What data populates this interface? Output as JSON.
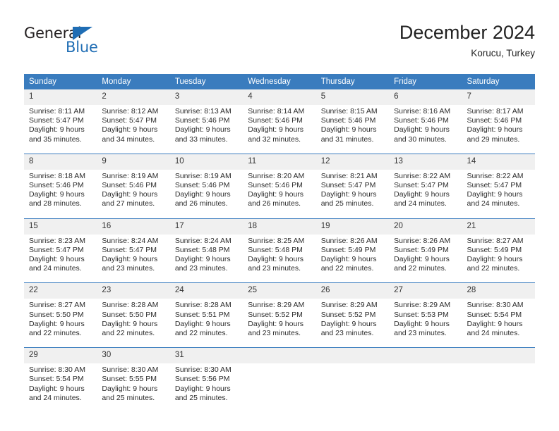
{
  "brand": {
    "name_part1": "General",
    "name_part2": "Blue",
    "triangle_color": "#1f6db4"
  },
  "header": {
    "title": "December 2024",
    "subtitle": "Korucu, Turkey"
  },
  "theme": {
    "header_blue": "#3a7cbe",
    "daynum_gray": "#f0f0f0"
  },
  "calendar": {
    "weekday_headers": [
      "Sunday",
      "Monday",
      "Tuesday",
      "Wednesday",
      "Thursday",
      "Friday",
      "Saturday"
    ],
    "weeks": [
      [
        {
          "day": "1",
          "sunrise": "Sunrise: 8:11 AM",
          "sunset": "Sunset: 5:47 PM",
          "daylight_line1": "Daylight: 9 hours",
          "daylight_line2": "and 35 minutes."
        },
        {
          "day": "2",
          "sunrise": "Sunrise: 8:12 AM",
          "sunset": "Sunset: 5:47 PM",
          "daylight_line1": "Daylight: 9 hours",
          "daylight_line2": "and 34 minutes."
        },
        {
          "day": "3",
          "sunrise": "Sunrise: 8:13 AM",
          "sunset": "Sunset: 5:46 PM",
          "daylight_line1": "Daylight: 9 hours",
          "daylight_line2": "and 33 minutes."
        },
        {
          "day": "4",
          "sunrise": "Sunrise: 8:14 AM",
          "sunset": "Sunset: 5:46 PM",
          "daylight_line1": "Daylight: 9 hours",
          "daylight_line2": "and 32 minutes."
        },
        {
          "day": "5",
          "sunrise": "Sunrise: 8:15 AM",
          "sunset": "Sunset: 5:46 PM",
          "daylight_line1": "Daylight: 9 hours",
          "daylight_line2": "and 31 minutes."
        },
        {
          "day": "6",
          "sunrise": "Sunrise: 8:16 AM",
          "sunset": "Sunset: 5:46 PM",
          "daylight_line1": "Daylight: 9 hours",
          "daylight_line2": "and 30 minutes."
        },
        {
          "day": "7",
          "sunrise": "Sunrise: 8:17 AM",
          "sunset": "Sunset: 5:46 PM",
          "daylight_line1": "Daylight: 9 hours",
          "daylight_line2": "and 29 minutes."
        }
      ],
      [
        {
          "day": "8",
          "sunrise": "Sunrise: 8:18 AM",
          "sunset": "Sunset: 5:46 PM",
          "daylight_line1": "Daylight: 9 hours",
          "daylight_line2": "and 28 minutes."
        },
        {
          "day": "9",
          "sunrise": "Sunrise: 8:19 AM",
          "sunset": "Sunset: 5:46 PM",
          "daylight_line1": "Daylight: 9 hours",
          "daylight_line2": "and 27 minutes."
        },
        {
          "day": "10",
          "sunrise": "Sunrise: 8:19 AM",
          "sunset": "Sunset: 5:46 PM",
          "daylight_line1": "Daylight: 9 hours",
          "daylight_line2": "and 26 minutes."
        },
        {
          "day": "11",
          "sunrise": "Sunrise: 8:20 AM",
          "sunset": "Sunset: 5:46 PM",
          "daylight_line1": "Daylight: 9 hours",
          "daylight_line2": "and 26 minutes."
        },
        {
          "day": "12",
          "sunrise": "Sunrise: 8:21 AM",
          "sunset": "Sunset: 5:47 PM",
          "daylight_line1": "Daylight: 9 hours",
          "daylight_line2": "and 25 minutes."
        },
        {
          "day": "13",
          "sunrise": "Sunrise: 8:22 AM",
          "sunset": "Sunset: 5:47 PM",
          "daylight_line1": "Daylight: 9 hours",
          "daylight_line2": "and 24 minutes."
        },
        {
          "day": "14",
          "sunrise": "Sunrise: 8:22 AM",
          "sunset": "Sunset: 5:47 PM",
          "daylight_line1": "Daylight: 9 hours",
          "daylight_line2": "and 24 minutes."
        }
      ],
      [
        {
          "day": "15",
          "sunrise": "Sunrise: 8:23 AM",
          "sunset": "Sunset: 5:47 PM",
          "daylight_line1": "Daylight: 9 hours",
          "daylight_line2": "and 24 minutes."
        },
        {
          "day": "16",
          "sunrise": "Sunrise: 8:24 AM",
          "sunset": "Sunset: 5:47 PM",
          "daylight_line1": "Daylight: 9 hours",
          "daylight_line2": "and 23 minutes."
        },
        {
          "day": "17",
          "sunrise": "Sunrise: 8:24 AM",
          "sunset": "Sunset: 5:48 PM",
          "daylight_line1": "Daylight: 9 hours",
          "daylight_line2": "and 23 minutes."
        },
        {
          "day": "18",
          "sunrise": "Sunrise: 8:25 AM",
          "sunset": "Sunset: 5:48 PM",
          "daylight_line1": "Daylight: 9 hours",
          "daylight_line2": "and 23 minutes."
        },
        {
          "day": "19",
          "sunrise": "Sunrise: 8:26 AM",
          "sunset": "Sunset: 5:49 PM",
          "daylight_line1": "Daylight: 9 hours",
          "daylight_line2": "and 22 minutes."
        },
        {
          "day": "20",
          "sunrise": "Sunrise: 8:26 AM",
          "sunset": "Sunset: 5:49 PM",
          "daylight_line1": "Daylight: 9 hours",
          "daylight_line2": "and 22 minutes."
        },
        {
          "day": "21",
          "sunrise": "Sunrise: 8:27 AM",
          "sunset": "Sunset: 5:49 PM",
          "daylight_line1": "Daylight: 9 hours",
          "daylight_line2": "and 22 minutes."
        }
      ],
      [
        {
          "day": "22",
          "sunrise": "Sunrise: 8:27 AM",
          "sunset": "Sunset: 5:50 PM",
          "daylight_line1": "Daylight: 9 hours",
          "daylight_line2": "and 22 minutes."
        },
        {
          "day": "23",
          "sunrise": "Sunrise: 8:28 AM",
          "sunset": "Sunset: 5:50 PM",
          "daylight_line1": "Daylight: 9 hours",
          "daylight_line2": "and 22 minutes."
        },
        {
          "day": "24",
          "sunrise": "Sunrise: 8:28 AM",
          "sunset": "Sunset: 5:51 PM",
          "daylight_line1": "Daylight: 9 hours",
          "daylight_line2": "and 22 minutes."
        },
        {
          "day": "25",
          "sunrise": "Sunrise: 8:29 AM",
          "sunset": "Sunset: 5:52 PM",
          "daylight_line1": "Daylight: 9 hours",
          "daylight_line2": "and 23 minutes."
        },
        {
          "day": "26",
          "sunrise": "Sunrise: 8:29 AM",
          "sunset": "Sunset: 5:52 PM",
          "daylight_line1": "Daylight: 9 hours",
          "daylight_line2": "and 23 minutes."
        },
        {
          "day": "27",
          "sunrise": "Sunrise: 8:29 AM",
          "sunset": "Sunset: 5:53 PM",
          "daylight_line1": "Daylight: 9 hours",
          "daylight_line2": "and 23 minutes."
        },
        {
          "day": "28",
          "sunrise": "Sunrise: 8:30 AM",
          "sunset": "Sunset: 5:54 PM",
          "daylight_line1": "Daylight: 9 hours",
          "daylight_line2": "and 24 minutes."
        }
      ],
      [
        {
          "day": "29",
          "sunrise": "Sunrise: 8:30 AM",
          "sunset": "Sunset: 5:54 PM",
          "daylight_line1": "Daylight: 9 hours",
          "daylight_line2": "and 24 minutes."
        },
        {
          "day": "30",
          "sunrise": "Sunrise: 8:30 AM",
          "sunset": "Sunset: 5:55 PM",
          "daylight_line1": "Daylight: 9 hours",
          "daylight_line2": "and 25 minutes."
        },
        {
          "day": "31",
          "sunrise": "Sunrise: 8:30 AM",
          "sunset": "Sunset: 5:56 PM",
          "daylight_line1": "Daylight: 9 hours",
          "daylight_line2": "and 25 minutes."
        },
        {
          "day": "",
          "sunrise": "",
          "sunset": "",
          "daylight_line1": "",
          "daylight_line2": ""
        },
        {
          "day": "",
          "sunrise": "",
          "sunset": "",
          "daylight_line1": "",
          "daylight_line2": ""
        },
        {
          "day": "",
          "sunrise": "",
          "sunset": "",
          "daylight_line1": "",
          "daylight_line2": ""
        },
        {
          "day": "",
          "sunrise": "",
          "sunset": "",
          "daylight_line1": "",
          "daylight_line2": ""
        }
      ]
    ]
  }
}
